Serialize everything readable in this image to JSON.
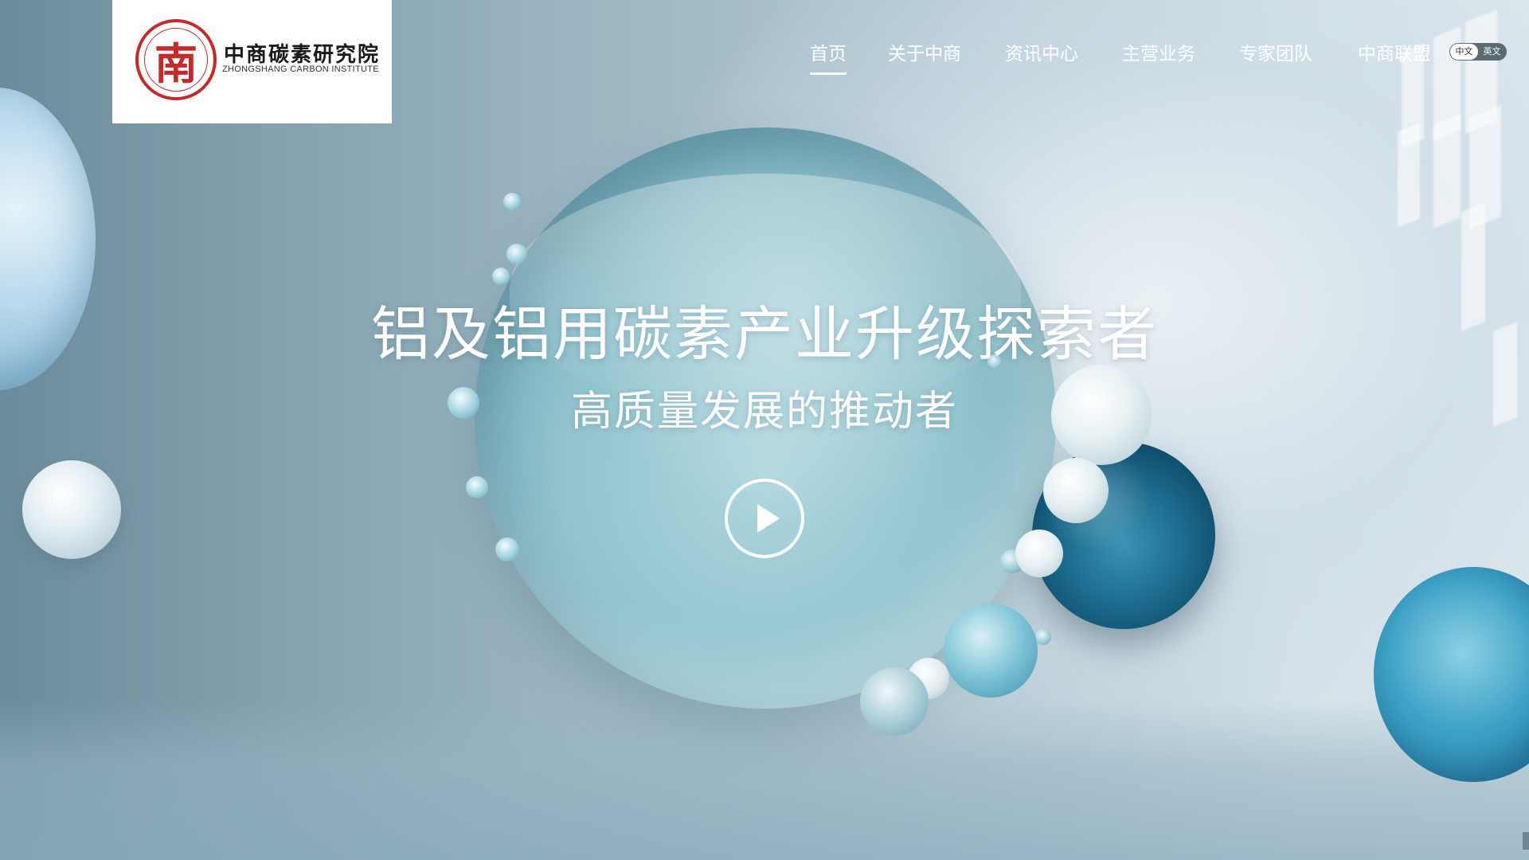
{
  "brand": {
    "emblem_char": "南",
    "name_cn": "中商碳素研究院",
    "name_en": "ZHONGSHANG CARBON INSTITUTE"
  },
  "nav": {
    "items": [
      {
        "label": "首页",
        "active": true
      },
      {
        "label": "关于中商",
        "active": false
      },
      {
        "label": "资讯中心",
        "active": false
      },
      {
        "label": "主营业务",
        "active": false
      },
      {
        "label": "专家团队",
        "active": false
      },
      {
        "label": "中商联盟",
        "active": false
      }
    ]
  },
  "language": {
    "options": [
      "中文",
      "英文"
    ],
    "selected": "中文"
  },
  "hero": {
    "title": "铝及铝用碳素产业升级探索者",
    "subtitle": "高质量发展的推动者",
    "play_icon": "play-icon"
  },
  "colors": {
    "brand_red": "#c42a2a",
    "text_white": "#ffffff"
  }
}
